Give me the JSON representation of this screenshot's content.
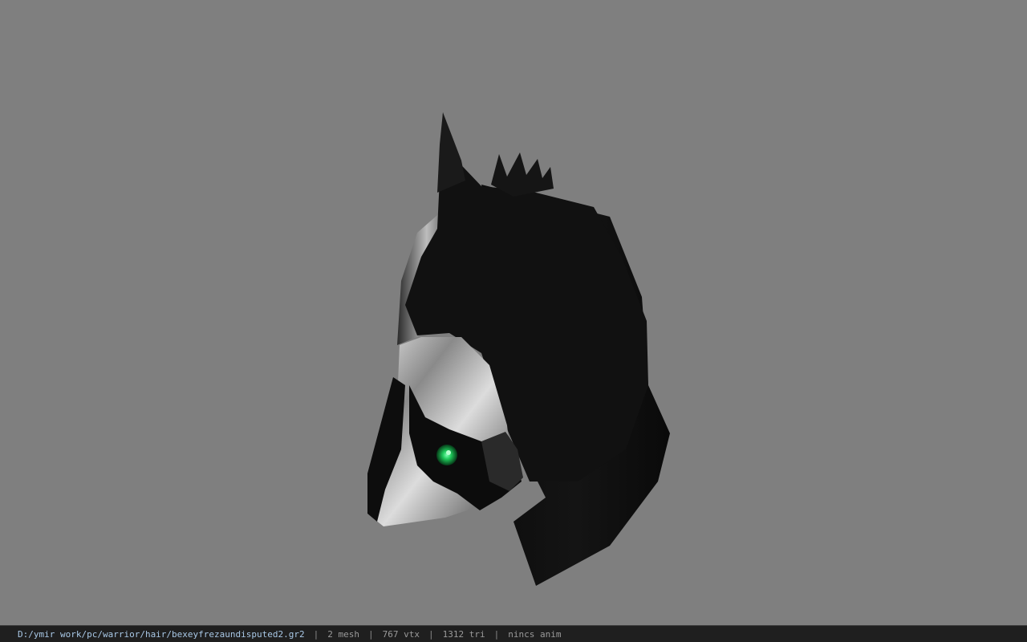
{
  "viewport": {
    "background": "#7f7f7f",
    "model": "hooded-helmet-mesh",
    "eye_color": "#1fc85a"
  },
  "status": {
    "path": "D:/ymir work/pc/warrior/hair/bexeyfrezaundisputed2.gr2",
    "separator": "|",
    "mesh": "2 mesh",
    "vtx": "767 vtx",
    "tri": "1312 tri",
    "anim": "nincs anim"
  }
}
